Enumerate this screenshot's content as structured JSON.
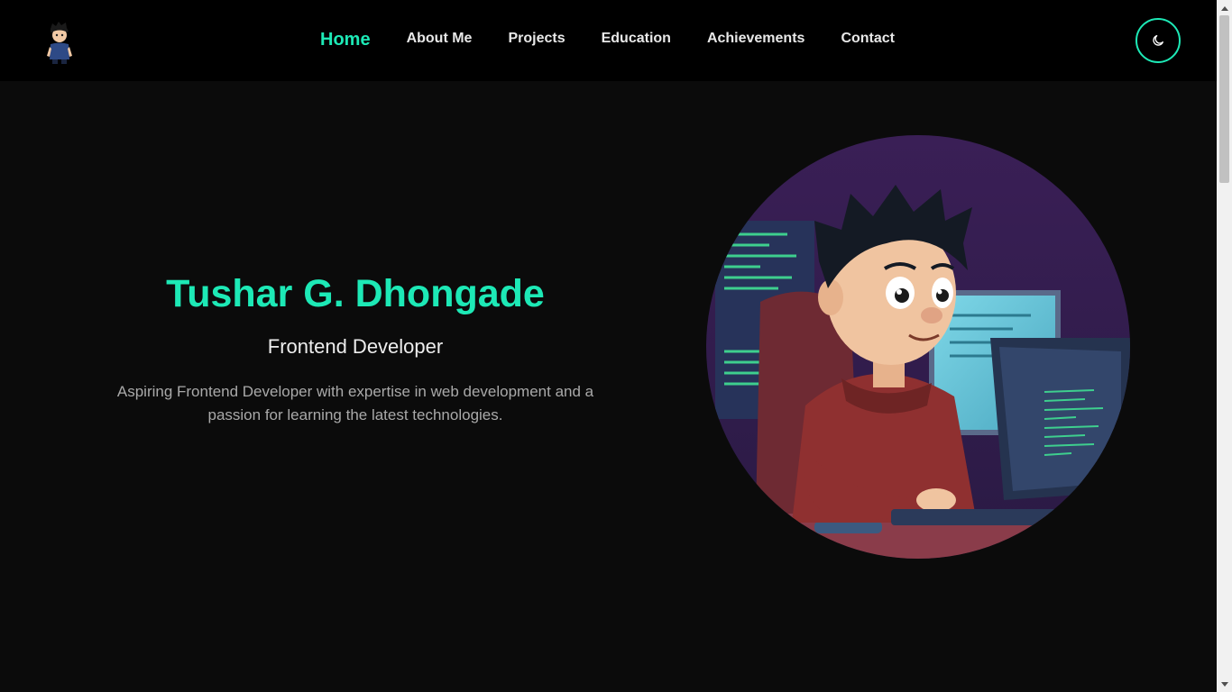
{
  "nav": {
    "items": [
      {
        "label": "Home",
        "active": true
      },
      {
        "label": "About Me",
        "active": false
      },
      {
        "label": "Projects",
        "active": false
      },
      {
        "label": "Education",
        "active": false
      },
      {
        "label": "Achievements",
        "active": false
      },
      {
        "label": "Contact",
        "active": false
      }
    ],
    "theme_toggle_icon": "moon-icon",
    "logo_icon": "avatar-logo-icon"
  },
  "hero": {
    "name": "Tushar G. Dhongade",
    "role": "Frontend Developer",
    "description": "Aspiring Frontend Developer with expertise in web development and a passion for learning the latest technologies.",
    "image_icon": "developer-illustration"
  },
  "colors": {
    "accent": "#1de9b6",
    "background": "#0b0b0b",
    "navbar": "#000000"
  }
}
